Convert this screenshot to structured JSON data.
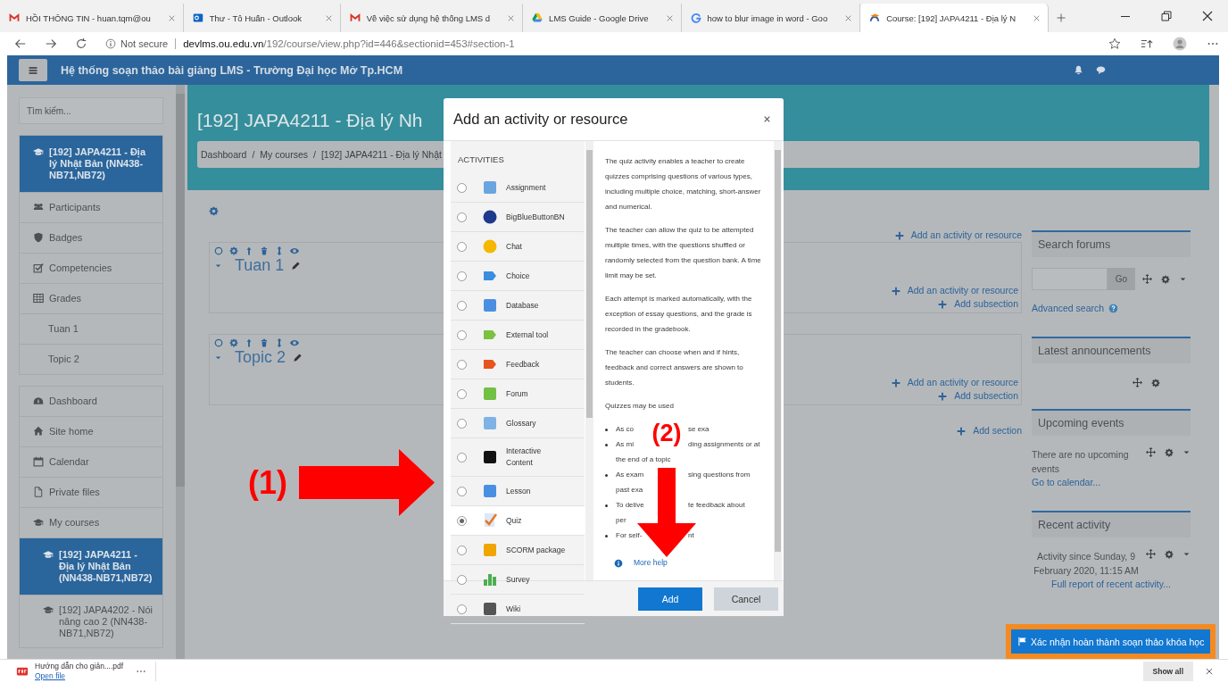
{
  "browser": {
    "tabs": [
      {
        "title": "HỒI THÔNG TIN - huan.tqm@ou",
        "kind": "mail",
        "selected": false
      },
      {
        "title": "Thư - Tô Huấn - Outlook",
        "kind": "outlook",
        "selected": false
      },
      {
        "title": "Về việc sử dụng hệ thống LMS d",
        "kind": "mail",
        "selected": false
      },
      {
        "title": "LMS Guide - Google Drive",
        "kind": "drive",
        "selected": false
      },
      {
        "title": "how to blur image in word - Goo",
        "kind": "search",
        "selected": false
      },
      {
        "title": "Course: [192] JAPA4211 - Địa lý N",
        "kind": "moodle",
        "selected": true
      }
    ],
    "security": "Not secure",
    "url_host": "devlms.ou.edu.vn",
    "url_path": "/192/course/view.php?id=446&sectionid=453#section-1"
  },
  "site": {
    "title": "Hệ thống soạn thảo bài giảng LMS - Trường Đại học Mở Tp.HCM"
  },
  "drawer": {
    "search_placeholder": "Tìm kiếm...",
    "groups": [
      {
        "items": [
          {
            "label": "[192] JAPA4211 - Địa lý Nhật Bản (NN438-NB71,NB72)",
            "kind": "course",
            "selected": true
          },
          {
            "label": "Participants",
            "kind": "participants",
            "selected": false
          },
          {
            "label": "Badges",
            "kind": "badges",
            "selected": false
          },
          {
            "label": "Competencies",
            "kind": "competencies",
            "selected": false
          },
          {
            "label": "Grades",
            "kind": "grades",
            "selected": false
          },
          {
            "label": "Tuan 1",
            "kind": "section",
            "selected": false
          },
          {
            "label": "Topic 2",
            "kind": "section",
            "selected": false
          }
        ]
      },
      {
        "items": [
          {
            "label": "Dashboard",
            "kind": "dashboard",
            "selected": false
          },
          {
            "label": "Site home",
            "kind": "home",
            "selected": false
          },
          {
            "label": "Calendar",
            "kind": "calendar",
            "selected": false
          },
          {
            "label": "Private files",
            "kind": "files",
            "selected": false
          },
          {
            "label": "My courses",
            "kind": "courses",
            "selected": false,
            "children": [
              {
                "label": "[192] JAPA4211 - Địa lý Nhật Bản (NN438-NB71,NB72)",
                "kind": "course",
                "selected": true
              },
              {
                "label": "[192] JAPA4202 - Nói nâng cao 2 (NN438-NB71,NB72)",
                "kind": "course",
                "selected": false
              }
            ]
          }
        ]
      }
    ]
  },
  "course": {
    "title": "[192] JAPA4211 - Địa lý Nh",
    "breadcrumb": [
      {
        "label": "Dashboard",
        "separator": "/"
      },
      {
        "label": "My courses",
        "separator": "/"
      },
      {
        "label": "[192] JAPA4211 - Địa lý Nhật"
      }
    ],
    "section_zero": {
      "add_activity": "Add an activity or resource"
    },
    "sections": [
      {
        "title": "Tuan 1",
        "add_activity": "Add an activity or resource",
        "add_subsection": "Add subsection"
      },
      {
        "title": "Topic 2",
        "add_activity": "Add an activity or resource",
        "add_subsection": "Add subsection"
      }
    ],
    "add_section": "Add section"
  },
  "blocks": [
    {
      "kind": "search_forums",
      "title": "Search forums",
      "button": "Go",
      "link": "Advanced search"
    },
    {
      "kind": "announcements",
      "title": "Latest announcements"
    },
    {
      "kind": "upcoming",
      "title": "Upcoming events",
      "text": "There are no upcoming events",
      "link": "Go to calendar..."
    },
    {
      "kind": "recent",
      "title": "Recent activity",
      "text": "Activity since Sunday, 9 February 2020, 11:15 AM",
      "link": "Full report of recent activity..."
    }
  ],
  "confirm_button": "Xác nhận hoàn thành soạn thảo khóa học",
  "modal": {
    "title": "Add an activity or resource",
    "heading": "ACTIVITIES",
    "activities": [
      {
        "name": "Assignment",
        "kind": "assignment",
        "selected": false
      },
      {
        "name": "BigBlueButtonBN",
        "kind": "bbb",
        "selected": false
      },
      {
        "name": "Chat",
        "kind": "chat",
        "selected": false
      },
      {
        "name": "Choice",
        "kind": "choice",
        "selected": false
      },
      {
        "name": "Database",
        "kind": "database",
        "selected": false
      },
      {
        "name": "External tool",
        "kind": "external",
        "selected": false
      },
      {
        "name": "Feedback",
        "kind": "feedback",
        "selected": false
      },
      {
        "name": "Forum",
        "kind": "forum",
        "selected": false
      },
      {
        "name": "Glossary",
        "kind": "glossary",
        "selected": false
      },
      {
        "name": "Interactive Content",
        "kind": "h5p",
        "selected": false
      },
      {
        "name": "Lesson",
        "kind": "lesson",
        "selected": false
      },
      {
        "name": "Quiz",
        "kind": "quiz",
        "selected": true
      },
      {
        "name": "SCORM package",
        "kind": "scorm",
        "selected": false
      },
      {
        "name": "Survey",
        "kind": "survey",
        "selected": false
      },
      {
        "name": "Wiki",
        "kind": "wiki",
        "selected": false
      }
    ],
    "description": [
      "The quiz activity enables a teacher to create quizzes comprising questions of various types, including multiple choice, matching, short-answer and numerical.",
      "The teacher can allow the quiz to be attempted multiple times, with the questions shuffled or randomly selected from the question bank. A time limit may be set.",
      "Each attempt is marked automatically, with the exception of essay questions, and the grade is recorded in the gradebook.",
      "The teacher can choose when and if hints, feedback and correct answers are shown to students.",
      "Quizzes may be used"
    ],
    "bullets": [
      {
        "left": "As co",
        "right": "se exa"
      },
      {
        "left": "As mi",
        "right": "ding assignments or at",
        "continuation": "the end of a topic"
      },
      {
        "left": "As exam",
        "right": "sing questions from",
        "continuation": "past exa"
      },
      {
        "left": "To delive",
        "right": "te feedback about",
        "continuation": "per"
      },
      {
        "left": "For self-",
        "right": "nt"
      }
    ],
    "help_link": "More help",
    "buttons": [
      {
        "label": "Add",
        "kind": "primary"
      },
      {
        "label": "Cancel",
        "kind": "secondary"
      }
    ]
  },
  "annotations": [
    {
      "label": "(1)"
    },
    {
      "label": "(2)"
    }
  ],
  "download_bar": {
    "file": "Hướng dẫn cho giản....pdf",
    "action": "Open file",
    "show_all": "Show all"
  }
}
